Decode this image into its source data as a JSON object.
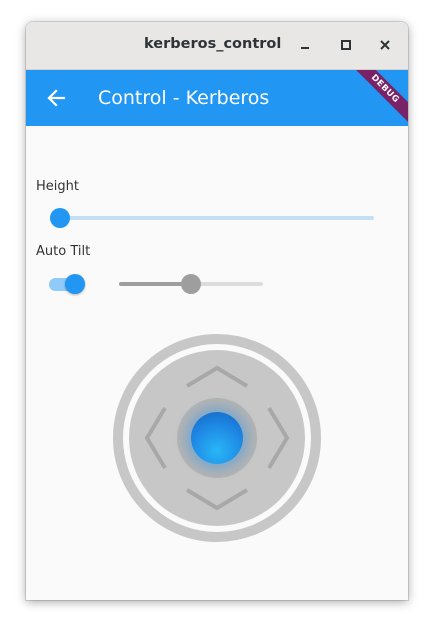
{
  "window": {
    "title": "kerberos_control"
  },
  "appbar": {
    "title": "Control - Kerberos",
    "debug_banner": "DEBUG",
    "color": "#2196f3"
  },
  "controls": {
    "height": {
      "label": "Height",
      "value": 0.0
    },
    "auto_tilt": {
      "label": "Auto Tilt",
      "switch_on": true,
      "slider_value": 0.5
    }
  },
  "joystick": {
    "directions": [
      "up",
      "down",
      "left",
      "right"
    ],
    "knob_color": "#1e88e5"
  },
  "icons": {
    "back": "arrow-left-icon",
    "minimize": "minimize-icon",
    "maximize": "maximize-icon",
    "close": "close-icon"
  }
}
